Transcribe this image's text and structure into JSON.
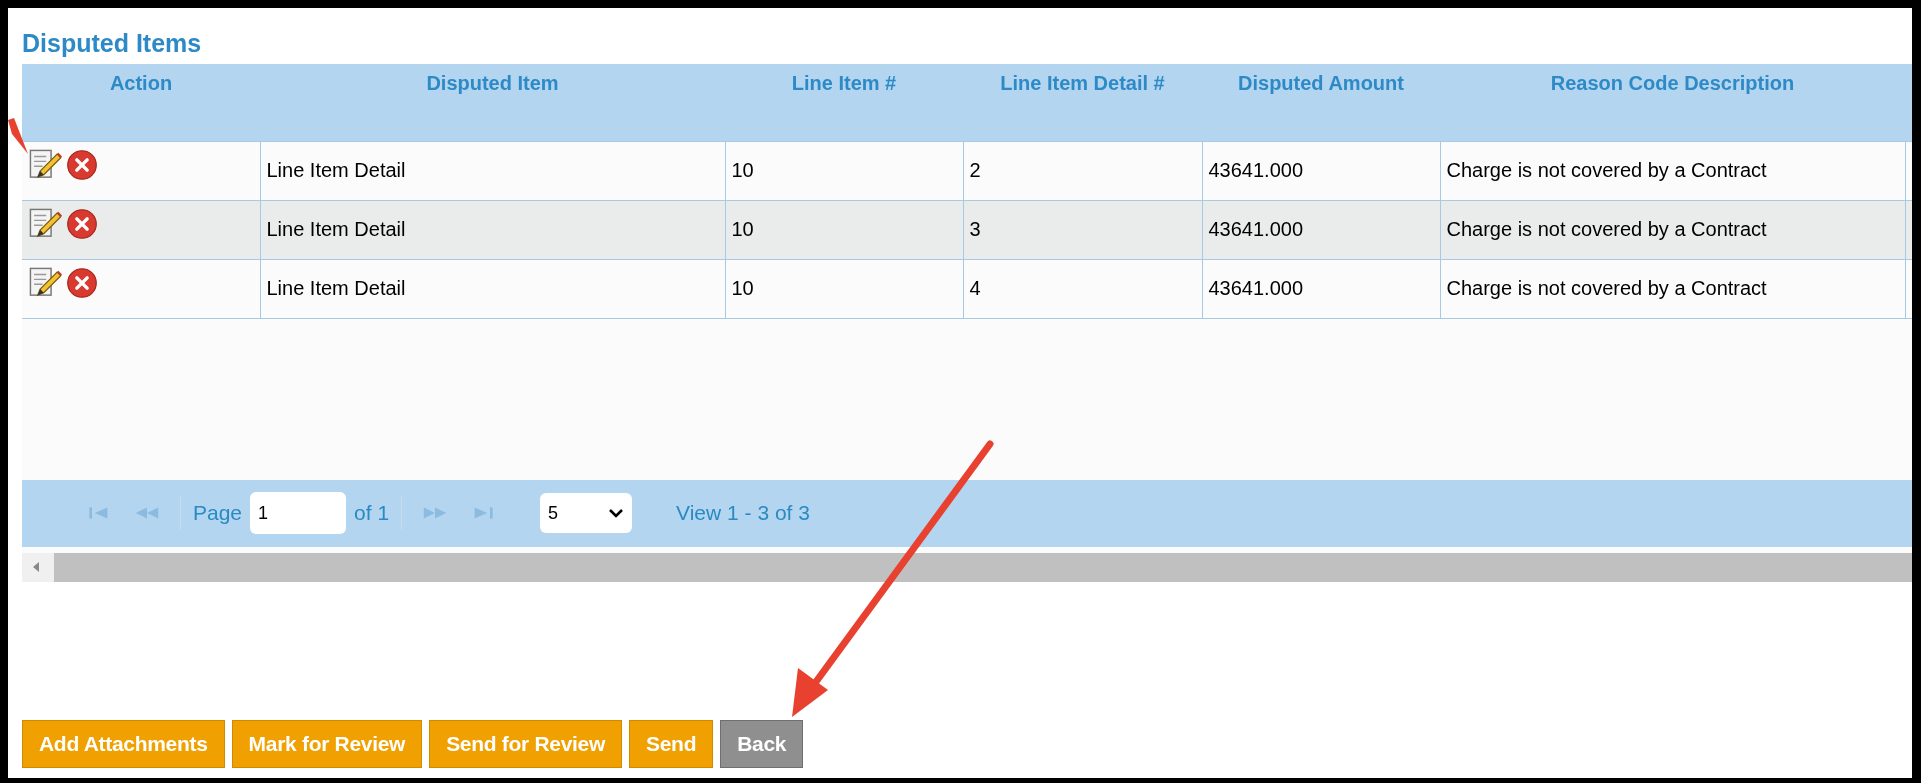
{
  "title": "Disputed Items",
  "table": {
    "action_column": "Action",
    "columns": [
      "Disputed Item",
      "Line Item #",
      "Line Item Detail #",
      "Disputed Amount",
      "Reason Code Description"
    ],
    "rows": [
      {
        "cells": [
          "Line Item Detail",
          "10",
          "2",
          "43641.000",
          "Charge is not covered by a Contract"
        ]
      },
      {
        "cells": [
          "Line Item Detail",
          "10",
          "3",
          "43641.000",
          "Charge is not covered by a Contract"
        ]
      },
      {
        "cells": [
          "Line Item Detail",
          "10",
          "4",
          "43641.000",
          "Charge is not covered by a Contract"
        ]
      }
    ]
  },
  "pager": {
    "page_label": "Page",
    "page_value": "1",
    "of_label": "of 1",
    "page_size": "5",
    "view": "View 1 - 3 of 3"
  },
  "buttons": [
    {
      "label": "Add Attachments",
      "kind": "primary"
    },
    {
      "label": "Mark for Review",
      "kind": "primary"
    },
    {
      "label": "Send for Review",
      "kind": "primary"
    },
    {
      "label": "Send",
      "kind": "primary"
    },
    {
      "label": "Back",
      "kind": "secondary"
    }
  ]
}
